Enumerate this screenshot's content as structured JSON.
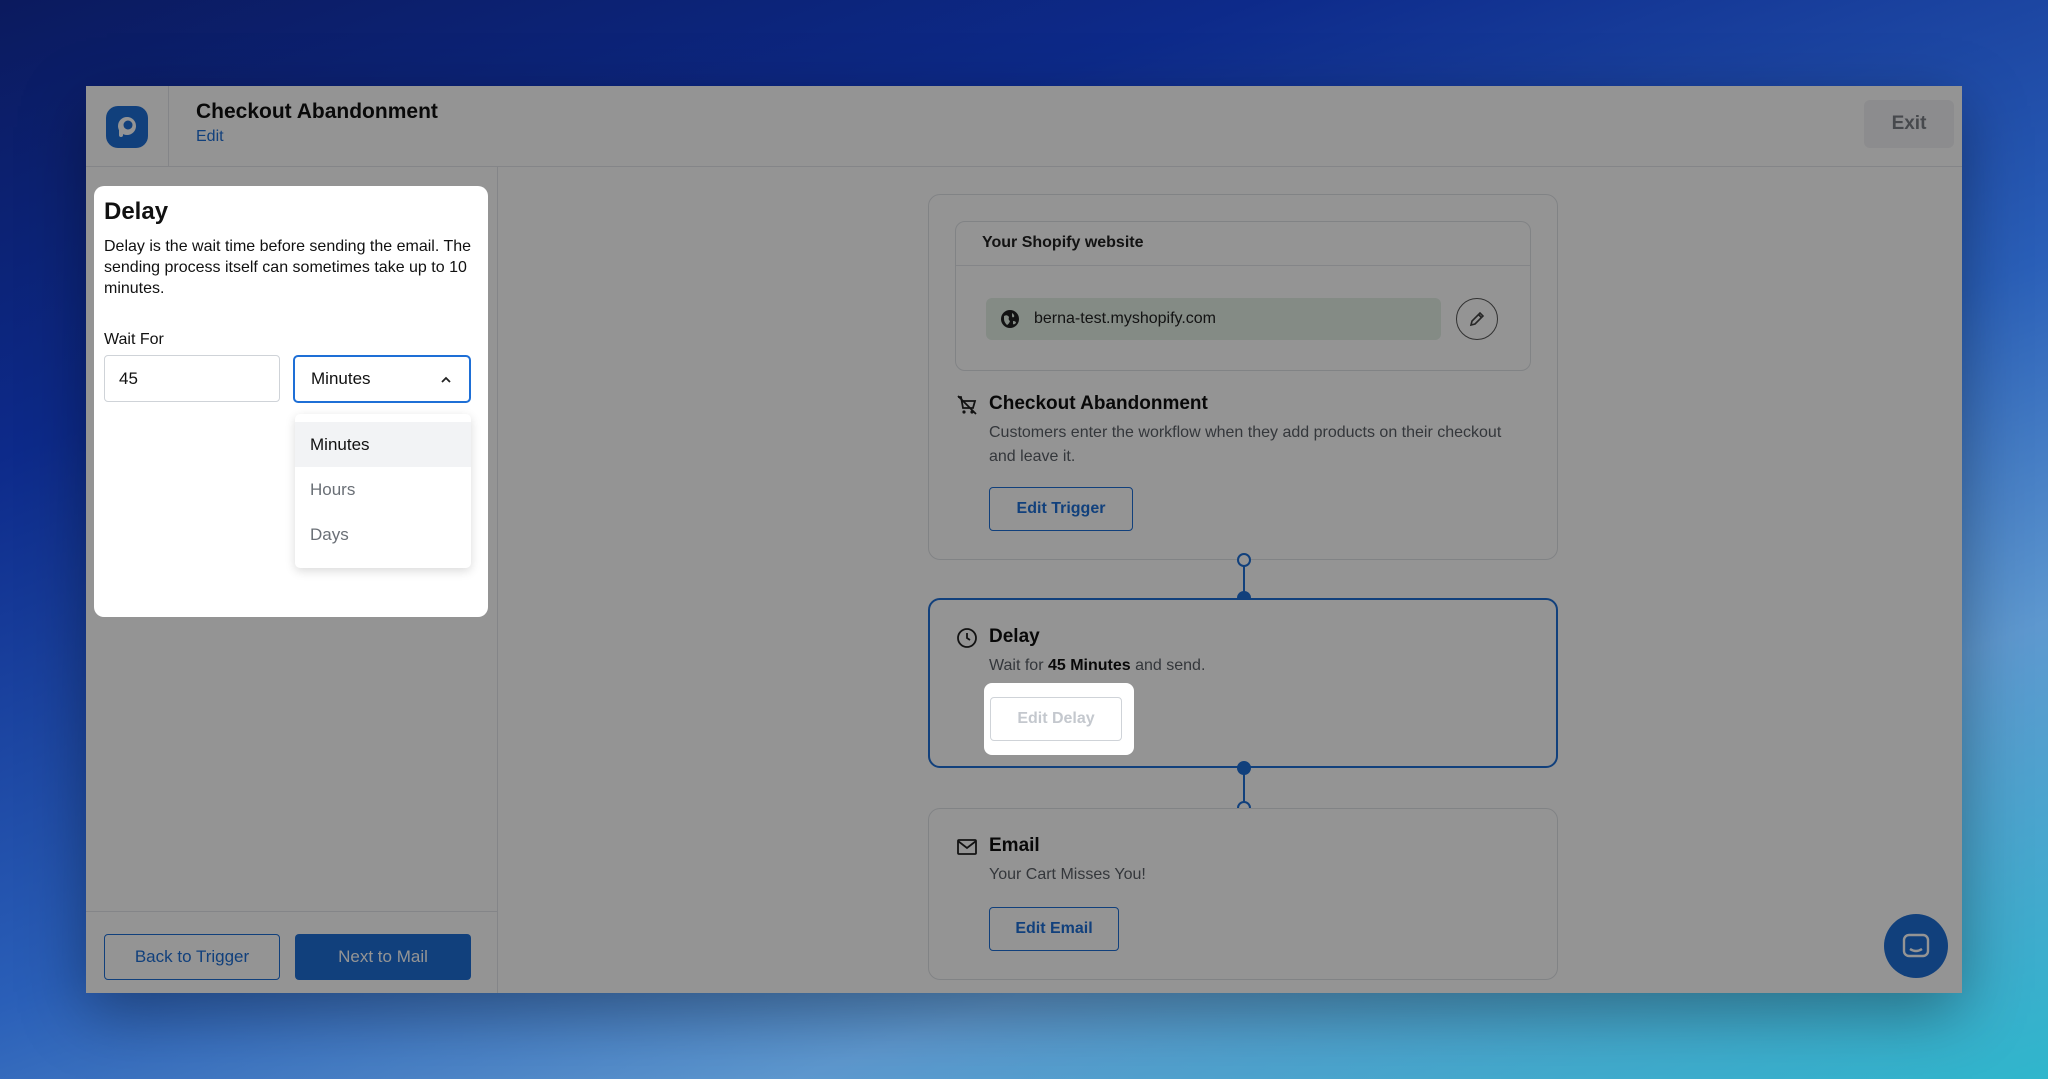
{
  "header": {
    "title": "Checkout Abandonment",
    "edit_link": "Edit",
    "exit_label": "Exit"
  },
  "delay_panel": {
    "title": "Delay",
    "description": "Delay is the wait time before sending the email. The sending process itself can sometimes take up to 10 minutes.",
    "wait_label": "Wait For",
    "wait_value": "45",
    "unit_selected": "Minutes",
    "unit_options": [
      "Minutes",
      "Hours",
      "Days"
    ]
  },
  "sidebar_footer": {
    "back_label": "Back to Trigger",
    "next_label": "Next to Mail"
  },
  "flow": {
    "trigger": {
      "website_heading": "Your Shopify website",
      "website_url": "berna-test.myshopify.com",
      "title": "Checkout Abandonment",
      "description": "Customers enter the workflow when they add products on their checkout and leave it.",
      "button": "Edit Trigger"
    },
    "delay": {
      "title": "Delay",
      "desc_prefix": "Wait for ",
      "desc_value": "45 Minutes",
      "desc_suffix": " and send.",
      "button": "Edit Delay"
    },
    "email": {
      "title": "Email",
      "subject": "Your Cart Misses You!",
      "button": "Edit Email"
    }
  },
  "colors": {
    "accent": "#1e6fd6",
    "overlay": "rgba(0,0,0,0.42)"
  },
  "icons": [
    "logo-icon",
    "globe-icon",
    "pencil-icon",
    "cart-off-icon",
    "clock-icon",
    "mail-icon",
    "chevron-up-icon",
    "chat-icon"
  ]
}
